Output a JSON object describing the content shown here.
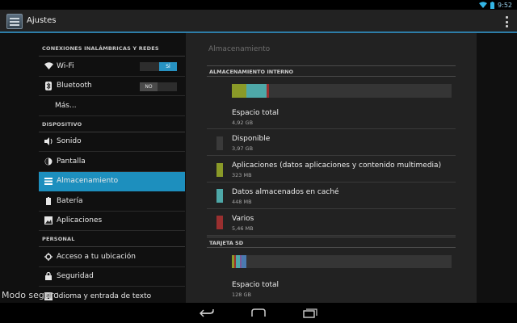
{
  "status": {
    "time": "9:52",
    "icons": [
      "wifi-icon",
      "battery-icon"
    ]
  },
  "actionbar": {
    "title": "Ajustes",
    "icon": "settings-app-icon",
    "overflow_icon": "overflow-menu-icon"
  },
  "sidebar": {
    "sections": [
      {
        "title": "CONEXIONES INALÁMBRICAS Y REDES",
        "items": [
          {
            "label": "Wi-Fi",
            "icon": "wifi-icon",
            "toggle": "SÍ",
            "toggle_state": "on"
          },
          {
            "label": "Bluetooth",
            "icon": "bluetooth-icon",
            "toggle": "NO",
            "toggle_state": "off"
          },
          {
            "label": "Más...",
            "icon": ""
          }
        ]
      },
      {
        "title": "DISPOSITIVO",
        "items": [
          {
            "label": "Sonido",
            "icon": "speaker-icon"
          },
          {
            "label": "Pantalla",
            "icon": "brightness-icon"
          },
          {
            "label": "Almacenamiento",
            "icon": "storage-icon",
            "active": true
          },
          {
            "label": "Batería",
            "icon": "battery-icon"
          },
          {
            "label": "Aplicaciones",
            "icon": "apps-icon"
          }
        ]
      },
      {
        "title": "PERSONAL",
        "items": [
          {
            "label": "Acceso a tu ubicación",
            "icon": "location-icon"
          },
          {
            "label": "Seguridad",
            "icon": "lock-icon"
          },
          {
            "label": "Idioma y entrada de texto",
            "icon": "language-icon"
          }
        ]
      }
    ]
  },
  "panel": {
    "title": "Almacenamiento",
    "internal": {
      "header": "ALMACENAMIENTO INTERNO",
      "bar": [
        {
          "color": "#8a9a28",
          "fraction": 0.066
        },
        {
          "color": "#4ea8a8",
          "fraction": 0.091
        },
        {
          "color": "#9a2f2f",
          "fraction": 0.011
        },
        {
          "color": "#353535",
          "fraction": 0.832
        }
      ],
      "entries": [
        {
          "title": "Espacio total",
          "size": "4,92 GB",
          "color": ""
        },
        {
          "title": "Disponible",
          "size": "3,97 GB",
          "color": "#3a3a3a"
        },
        {
          "title": "Aplicaciones (datos aplicaciones y contenido multimedia)",
          "size": "323 MB",
          "color": "#8a9a28"
        },
        {
          "title": "Datos almacenados en caché",
          "size": "448 MB",
          "color": "#4ea8a8"
        },
        {
          "title": "Varios",
          "size": "5,46 MB",
          "color": "#9a2f2f"
        }
      ]
    },
    "sd": {
      "header": "TARJETA SD",
      "bar": [
        {
          "color": "#8a9a28",
          "fraction": 0.01
        },
        {
          "color": "#9a2f2f",
          "fraction": 0.01
        },
        {
          "color": "#4ea8a8",
          "fraction": 0.015
        },
        {
          "color": "#7a5a9a",
          "fraction": 0.01
        },
        {
          "color": "#4a7ab0",
          "fraction": 0.02
        },
        {
          "color": "#353535",
          "fraction": 0.935
        }
      ],
      "entries": [
        {
          "title": "Espacio total",
          "size": "128 GB",
          "color": ""
        }
      ]
    }
  },
  "watermark": "Modo seguro",
  "navbar": {
    "buttons": [
      "back-icon",
      "home-icon",
      "recent-apps-icon"
    ]
  }
}
